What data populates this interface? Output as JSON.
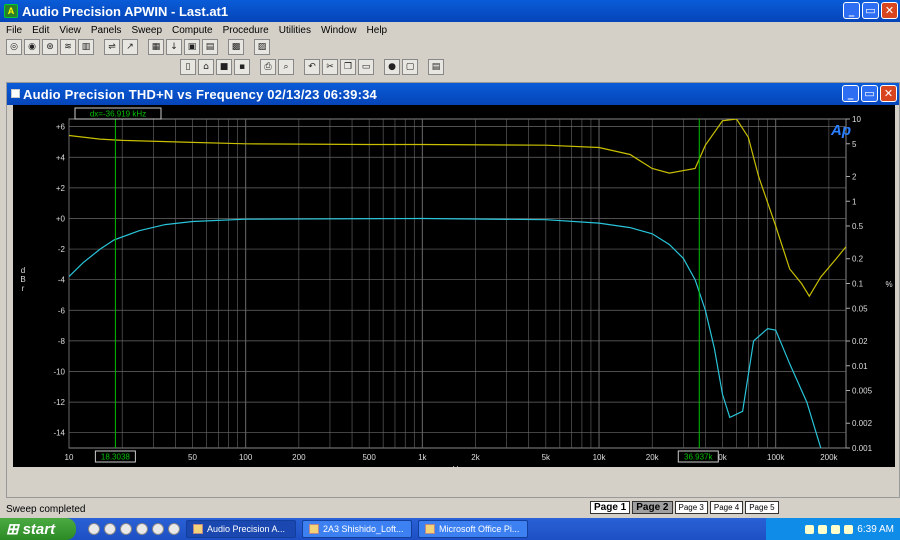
{
  "app": {
    "title": "Audio Precision APWIN - Last.at1"
  },
  "menu": [
    "File",
    "Edit",
    "View",
    "Panels",
    "Sweep",
    "Compute",
    "Procedure",
    "Utilities",
    "Window",
    "Help"
  ],
  "graph_window": {
    "title": "Audio Precision  THD+N vs Frequency  02/13/23 06:39:34"
  },
  "cursor": {
    "dx_label": "dx=-36.919 kHz",
    "left_readout": "18.3038",
    "right_readout": "36.937k"
  },
  "status": {
    "text": "Sweep completed"
  },
  "pages": [
    "Page 1",
    "Page 2",
    "Page 3",
    "Page 4",
    "Page 5"
  ],
  "taskbar": {
    "start_label": "start",
    "tasks": [
      "Audio Precision A...",
      "2A3 Shishido_Loft...",
      "Microsoft Office Pi..."
    ],
    "clock": "6:39 AM"
  },
  "colors": {
    "yellow_trace": "#c8c000",
    "cyan_trace": "#29c4d9",
    "grid": "#6a6a6a",
    "cursor": "#00c000"
  },
  "chart_data": {
    "type": "line",
    "title": "",
    "xlabel": "Hz",
    "ylabel_left": "d B r",
    "ylabel_right": "%",
    "x_scale": "log",
    "xlim": [
      10,
      250000
    ],
    "ylim_left": [
      -15,
      6.5
    ],
    "ylim_right": [
      0.001,
      10
    ],
    "x_ticks": [
      {
        "v": 10,
        "l": "10"
      },
      {
        "v": 50,
        "l": "50"
      },
      {
        "v": 100,
        "l": "100"
      },
      {
        "v": 200,
        "l": "200"
      },
      {
        "v": 500,
        "l": "500"
      },
      {
        "v": 1000,
        "l": "1k"
      },
      {
        "v": 2000,
        "l": "2k"
      },
      {
        "v": 5000,
        "l": "5k"
      },
      {
        "v": 10000,
        "l": "10k"
      },
      {
        "v": 20000,
        "l": "20k"
      },
      {
        "v": 50000,
        "l": "0k"
      },
      {
        "v": 100000,
        "l": "100k"
      },
      {
        "v": 200000,
        "l": "200k"
      }
    ],
    "y_left_ticks": [
      {
        "v": 6,
        "l": "+6"
      },
      {
        "v": 4,
        "l": "+4"
      },
      {
        "v": 2,
        "l": "+2"
      },
      {
        "v": 0,
        "l": "+0"
      },
      {
        "v": -2,
        "l": "-2"
      },
      {
        "v": -4,
        "l": "-4"
      },
      {
        "v": -6,
        "l": "-6"
      },
      {
        "v": -8,
        "l": "-8"
      },
      {
        "v": -10,
        "l": "-10"
      },
      {
        "v": -12,
        "l": "-12"
      },
      {
        "v": -14,
        "l": "-14"
      }
    ],
    "y_right_ticks": [
      {
        "v": 10,
        "l": "10"
      },
      {
        "v": 5,
        "l": "5"
      },
      {
        "v": 2,
        "l": "2"
      },
      {
        "v": 1,
        "l": "1"
      },
      {
        "v": 0.5,
        "l": "0.5"
      },
      {
        "v": 0.2,
        "l": "0.2"
      },
      {
        "v": 0.1,
        "l": "0.1"
      },
      {
        "v": 0.05,
        "l": "0.05"
      },
      {
        "v": 0.02,
        "l": "0.02"
      },
      {
        "v": 0.01,
        "l": "0.01"
      },
      {
        "v": 0.005,
        "l": "0.005"
      },
      {
        "v": 0.002,
        "l": "0.002"
      },
      {
        "v": 0.001,
        "l": "0.001"
      }
    ],
    "cursors_hz": [
      18.3038,
      36937
    ],
    "series": [
      {
        "axis": "left",
        "color": "#29c4d9",
        "points": [
          [
            10,
            -3.8
          ],
          [
            12,
            -2.9
          ],
          [
            15,
            -2.0
          ],
          [
            18,
            -1.4
          ],
          [
            25,
            -0.8
          ],
          [
            35,
            -0.4
          ],
          [
            50,
            -0.2
          ],
          [
            100,
            -0.05
          ],
          [
            1000,
            0
          ],
          [
            5000,
            -0.08
          ],
          [
            10000,
            -0.3
          ],
          [
            15000,
            -0.6
          ],
          [
            20000,
            -1.0
          ],
          [
            25000,
            -1.7
          ],
          [
            30000,
            -2.6
          ],
          [
            35000,
            -4.0
          ],
          [
            40000,
            -6.0
          ],
          [
            45000,
            -8.5
          ],
          [
            50000,
            -11.5
          ],
          [
            55000,
            -13.0
          ],
          [
            65000,
            -12.6
          ],
          [
            75000,
            -8.0
          ],
          [
            90000,
            -7.2
          ],
          [
            100000,
            -7.3
          ],
          [
            120000,
            -9.5
          ],
          [
            150000,
            -12.0
          ],
          [
            180000,
            -15.0
          ]
        ]
      },
      {
        "axis": "right",
        "color": "#c8c000",
        "points": [
          [
            10,
            6.3
          ],
          [
            15,
            5.7
          ],
          [
            20,
            5.5
          ],
          [
            50,
            5.2
          ],
          [
            100,
            5.0
          ],
          [
            500,
            4.9
          ],
          [
            1000,
            4.9
          ],
          [
            5000,
            4.8
          ],
          [
            10000,
            4.5
          ],
          [
            15000,
            3.7
          ],
          [
            20000,
            2.5
          ],
          [
            25000,
            2.2
          ],
          [
            35000,
            2.5
          ],
          [
            40000,
            4.8
          ],
          [
            50000,
            9.5
          ],
          [
            60000,
            10
          ],
          [
            70000,
            6.0
          ],
          [
            80000,
            2.0
          ],
          [
            100000,
            0.5
          ],
          [
            120000,
            0.15
          ],
          [
            140000,
            0.1
          ],
          [
            155000,
            0.07
          ],
          [
            180000,
            0.12
          ],
          [
            220000,
            0.2
          ],
          [
            250000,
            0.28
          ]
        ]
      }
    ]
  }
}
